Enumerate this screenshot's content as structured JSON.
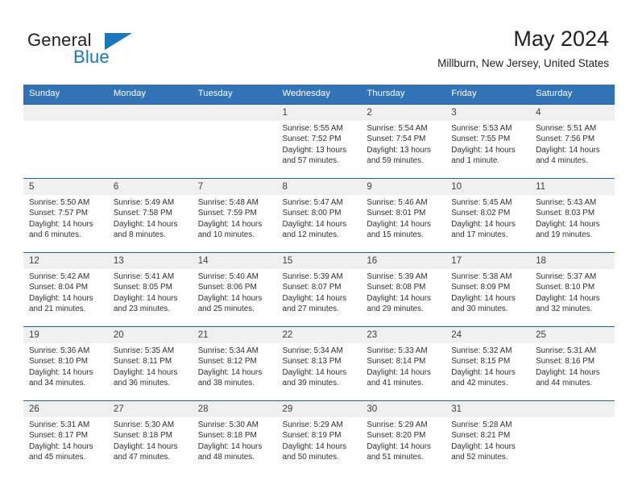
{
  "brand": {
    "name_part1": "General",
    "name_part2": "Blue",
    "triangle_icon": "triangle-icon",
    "accent": "#1c76bc"
  },
  "header": {
    "month_title": "May 2024",
    "location": "Millburn, New Jersey, United States"
  },
  "theme": {
    "header_row_bg": "#3272b6",
    "day_band_bg": "#f0f0f0",
    "row_border": "#2a6099",
    "text": "#2f2f2f"
  },
  "weekday_headers": [
    "Sunday",
    "Monday",
    "Tuesday",
    "Wednesday",
    "Thursday",
    "Friday",
    "Saturday"
  ],
  "labels": {
    "sunrise": "Sunrise:",
    "sunset": "Sunset:",
    "daylight": "Daylight:"
  },
  "weeks": [
    [
      {
        "day": "",
        "empty": true
      },
      {
        "day": "",
        "empty": true
      },
      {
        "day": "",
        "empty": true
      },
      {
        "day": "1",
        "sunrise": "Sunrise: 5:55 AM",
        "sunset": "Sunset: 7:52 PM",
        "daylight": "Daylight: 13 hours and 57 minutes."
      },
      {
        "day": "2",
        "sunrise": "Sunrise: 5:54 AM",
        "sunset": "Sunset: 7:54 PM",
        "daylight": "Daylight: 13 hours and 59 minutes."
      },
      {
        "day": "3",
        "sunrise": "Sunrise: 5:53 AM",
        "sunset": "Sunset: 7:55 PM",
        "daylight": "Daylight: 14 hours and 1 minute."
      },
      {
        "day": "4",
        "sunrise": "Sunrise: 5:51 AM",
        "sunset": "Sunset: 7:56 PM",
        "daylight": "Daylight: 14 hours and 4 minutes."
      }
    ],
    [
      {
        "day": "5",
        "sunrise": "Sunrise: 5:50 AM",
        "sunset": "Sunset: 7:57 PM",
        "daylight": "Daylight: 14 hours and 6 minutes."
      },
      {
        "day": "6",
        "sunrise": "Sunrise: 5:49 AM",
        "sunset": "Sunset: 7:58 PM",
        "daylight": "Daylight: 14 hours and 8 minutes."
      },
      {
        "day": "7",
        "sunrise": "Sunrise: 5:48 AM",
        "sunset": "Sunset: 7:59 PM",
        "daylight": "Daylight: 14 hours and 10 minutes."
      },
      {
        "day": "8",
        "sunrise": "Sunrise: 5:47 AM",
        "sunset": "Sunset: 8:00 PM",
        "daylight": "Daylight: 14 hours and 12 minutes."
      },
      {
        "day": "9",
        "sunrise": "Sunrise: 5:46 AM",
        "sunset": "Sunset: 8:01 PM",
        "daylight": "Daylight: 14 hours and 15 minutes."
      },
      {
        "day": "10",
        "sunrise": "Sunrise: 5:45 AM",
        "sunset": "Sunset: 8:02 PM",
        "daylight": "Daylight: 14 hours and 17 minutes."
      },
      {
        "day": "11",
        "sunrise": "Sunrise: 5:43 AM",
        "sunset": "Sunset: 8:03 PM",
        "daylight": "Daylight: 14 hours and 19 minutes."
      }
    ],
    [
      {
        "day": "12",
        "sunrise": "Sunrise: 5:42 AM",
        "sunset": "Sunset: 8:04 PM",
        "daylight": "Daylight: 14 hours and 21 minutes."
      },
      {
        "day": "13",
        "sunrise": "Sunrise: 5:41 AM",
        "sunset": "Sunset: 8:05 PM",
        "daylight": "Daylight: 14 hours and 23 minutes."
      },
      {
        "day": "14",
        "sunrise": "Sunrise: 5:40 AM",
        "sunset": "Sunset: 8:06 PM",
        "daylight": "Daylight: 14 hours and 25 minutes."
      },
      {
        "day": "15",
        "sunrise": "Sunrise: 5:39 AM",
        "sunset": "Sunset: 8:07 PM",
        "daylight": "Daylight: 14 hours and 27 minutes."
      },
      {
        "day": "16",
        "sunrise": "Sunrise: 5:39 AM",
        "sunset": "Sunset: 8:08 PM",
        "daylight": "Daylight: 14 hours and 29 minutes."
      },
      {
        "day": "17",
        "sunrise": "Sunrise: 5:38 AM",
        "sunset": "Sunset: 8:09 PM",
        "daylight": "Daylight: 14 hours and 30 minutes."
      },
      {
        "day": "18",
        "sunrise": "Sunrise: 5:37 AM",
        "sunset": "Sunset: 8:10 PM",
        "daylight": "Daylight: 14 hours and 32 minutes."
      }
    ],
    [
      {
        "day": "19",
        "sunrise": "Sunrise: 5:36 AM",
        "sunset": "Sunset: 8:10 PM",
        "daylight": "Daylight: 14 hours and 34 minutes."
      },
      {
        "day": "20",
        "sunrise": "Sunrise: 5:35 AM",
        "sunset": "Sunset: 8:11 PM",
        "daylight": "Daylight: 14 hours and 36 minutes."
      },
      {
        "day": "21",
        "sunrise": "Sunrise: 5:34 AM",
        "sunset": "Sunset: 8:12 PM",
        "daylight": "Daylight: 14 hours and 38 minutes."
      },
      {
        "day": "22",
        "sunrise": "Sunrise: 5:34 AM",
        "sunset": "Sunset: 8:13 PM",
        "daylight": "Daylight: 14 hours and 39 minutes."
      },
      {
        "day": "23",
        "sunrise": "Sunrise: 5:33 AM",
        "sunset": "Sunset: 8:14 PM",
        "daylight": "Daylight: 14 hours and 41 minutes."
      },
      {
        "day": "24",
        "sunrise": "Sunrise: 5:32 AM",
        "sunset": "Sunset: 8:15 PM",
        "daylight": "Daylight: 14 hours and 42 minutes."
      },
      {
        "day": "25",
        "sunrise": "Sunrise: 5:31 AM",
        "sunset": "Sunset: 8:16 PM",
        "daylight": "Daylight: 14 hours and 44 minutes."
      }
    ],
    [
      {
        "day": "26",
        "sunrise": "Sunrise: 5:31 AM",
        "sunset": "Sunset: 8:17 PM",
        "daylight": "Daylight: 14 hours and 45 minutes."
      },
      {
        "day": "27",
        "sunrise": "Sunrise: 5:30 AM",
        "sunset": "Sunset: 8:18 PM",
        "daylight": "Daylight: 14 hours and 47 minutes."
      },
      {
        "day": "28",
        "sunrise": "Sunrise: 5:30 AM",
        "sunset": "Sunset: 8:18 PM",
        "daylight": "Daylight: 14 hours and 48 minutes."
      },
      {
        "day": "29",
        "sunrise": "Sunrise: 5:29 AM",
        "sunset": "Sunset: 8:19 PM",
        "daylight": "Daylight: 14 hours and 50 minutes."
      },
      {
        "day": "30",
        "sunrise": "Sunrise: 5:29 AM",
        "sunset": "Sunset: 8:20 PM",
        "daylight": "Daylight: 14 hours and 51 minutes."
      },
      {
        "day": "31",
        "sunrise": "Sunrise: 5:28 AM",
        "sunset": "Sunset: 8:21 PM",
        "daylight": "Daylight: 14 hours and 52 minutes."
      },
      {
        "day": "",
        "empty": true
      }
    ]
  ]
}
